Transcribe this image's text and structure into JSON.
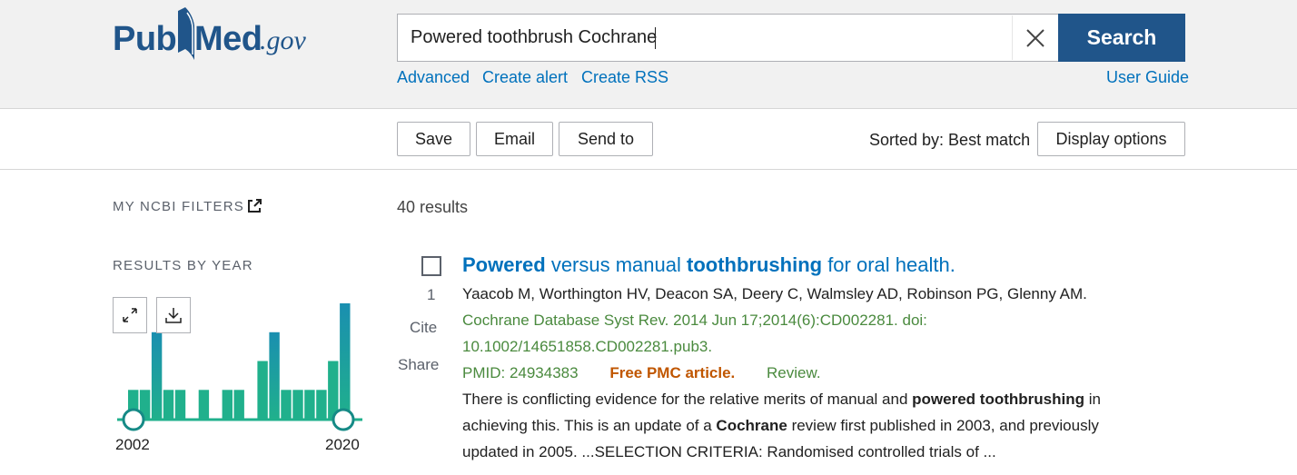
{
  "header": {
    "logo": {
      "part1": "Pub",
      "part2": "Med",
      "suffix": ".gov"
    },
    "search": {
      "value": "Powered toothbrush Cochrane",
      "placeholder": ""
    },
    "search_button": "Search",
    "links": {
      "advanced": "Advanced",
      "create_alert": "Create alert",
      "create_rss": "Create RSS",
      "user_guide": "User Guide"
    }
  },
  "toolbar": {
    "save": "Save",
    "email": "Email",
    "send_to": "Send to",
    "sorted_by": "Sorted by: Best match",
    "display_options": "Display options"
  },
  "sidebar": {
    "my_filters": "MY NCBI FILTERS",
    "results_by_year": "RESULTS BY YEAR",
    "chart_data": {
      "type": "bar",
      "categories": [
        "2002",
        "2003",
        "2004",
        "2005",
        "2006",
        "2007",
        "2008",
        "2009",
        "2010",
        "2011",
        "2012",
        "2013",
        "2014",
        "2015",
        "2016",
        "2017",
        "2018",
        "2019",
        "2020"
      ],
      "values": [
        1,
        1,
        3,
        1,
        1,
        0,
        1,
        0,
        1,
        1,
        0,
        2,
        3,
        1,
        1,
        1,
        1,
        2,
        4
      ],
      "start_label": "2002",
      "end_label": "2020",
      "bar_color": "#20b08c",
      "selected_color": "#1a8fb0"
    }
  },
  "results": {
    "count": "40 results",
    "items": [
      {
        "number": "1",
        "title_parts": [
          {
            "text": "Powered",
            "bold": true
          },
          {
            "text": " versus manual ",
            "bold": false
          },
          {
            "text": "toothbrushing",
            "bold": true
          },
          {
            "text": " for oral health.",
            "bold": false
          }
        ],
        "authors": "Yaacob M, Worthington HV, Deacon SA, Deery C, Walmsley AD, Robinson PG, Glenny AM.",
        "citation_line1": "Cochrane Database Syst Rev. 2014 Jun 17;2014(6):CD002281. doi:",
        "citation_line2": "10.1002/14651858.CD002281.pub3.",
        "pmid": "PMID: 24934383",
        "free": "Free PMC article.",
        "type": "Review.",
        "snippet": [
          [
            {
              "text": "There is conflicting evidence for the relative merits of manual and ",
              "bold": false
            },
            {
              "text": "powered",
              "bold": true
            },
            {
              "text": " ",
              "bold": false
            },
            {
              "text": "toothbrushing",
              "bold": true
            },
            {
              "text": " in",
              "bold": false
            }
          ],
          [
            {
              "text": "achieving this. This is an update of a ",
              "bold": false
            },
            {
              "text": "Cochrane",
              "bold": true
            },
            {
              "text": " review first published in 2003, and previously",
              "bold": false
            }
          ],
          [
            {
              "text": "updated in 2005. ...SELECTION CRITERIA: Randomised controlled trials of ...",
              "bold": false
            }
          ]
        ],
        "actions": {
          "cite": "Cite",
          "share": "Share"
        }
      }
    ]
  },
  "colors": {
    "brand": "#20558a",
    "link": "#0071bc",
    "green": "#4a8a3e",
    "free": "#c05600"
  }
}
